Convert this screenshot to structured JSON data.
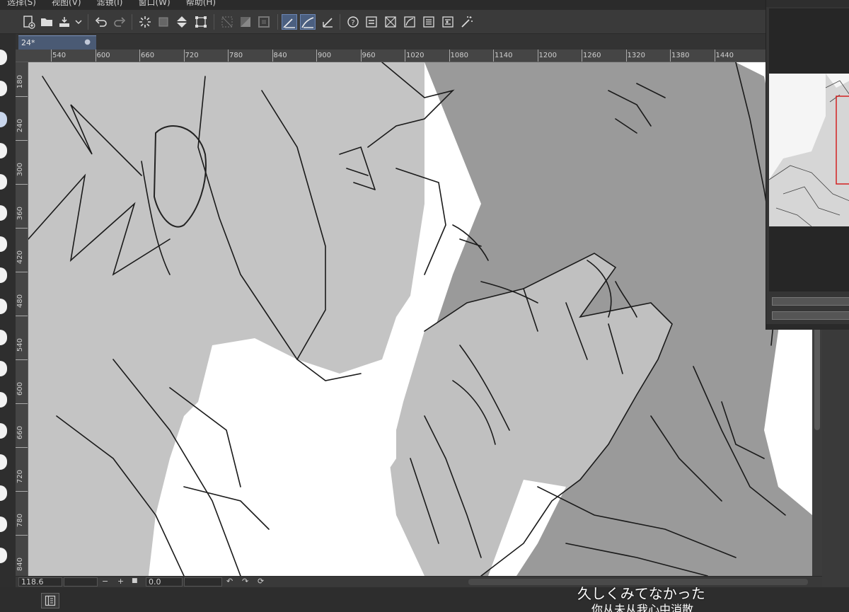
{
  "menu": [
    "选择(S)",
    "视图(V)",
    "滤镜(I)",
    "窗口(W)",
    "帮助(H)"
  ],
  "toolbar_icons": [
    "new-canvas-icon",
    "open-folder-icon",
    "save-icon",
    "dropdown-arrow-icon",
    "undo-icon",
    "redo-icon",
    "loading-spinner-icon",
    "transparent-clear-icon",
    "fill-icon",
    "transform-icon",
    "deselect-icon",
    "invert-selection-icon",
    "selection-border-icon",
    "ruler-snap-icon",
    "curve-snap-icon",
    "perspective-snap-icon",
    "help-icon",
    "layer-adjust-icon",
    "distort-icon",
    "tonal-icon",
    "levels-icon",
    "correction-icon",
    "magic-icon"
  ],
  "tab": {
    "title": "24*",
    "close": "●"
  },
  "ruler": {
    "h_labels": [
      "540",
      "600",
      "660",
      "720",
      "780",
      "840",
      "900",
      "960",
      "1020",
      "1080",
      "1140",
      "1200",
      "1260",
      "1320",
      "1380",
      "1440"
    ],
    "v_labels": [
      "180",
      "240",
      "300",
      "360",
      "420",
      "480",
      "540",
      "600",
      "660",
      "720",
      "780",
      "840"
    ]
  },
  "status": {
    "zoom": "118.6",
    "minus": "−",
    "plus": "+",
    "stop": "■",
    "angle": "0.0",
    "rotate_left": "↶",
    "rotate_right": "↷",
    "reset": "⟳"
  },
  "subtitles": {
    "japanese": "久しくみてなかった",
    "chinese": "你从未从我心中消散"
  },
  "colors": {
    "active_tool": "#4b5f80",
    "nav_frame": "#d42020"
  }
}
